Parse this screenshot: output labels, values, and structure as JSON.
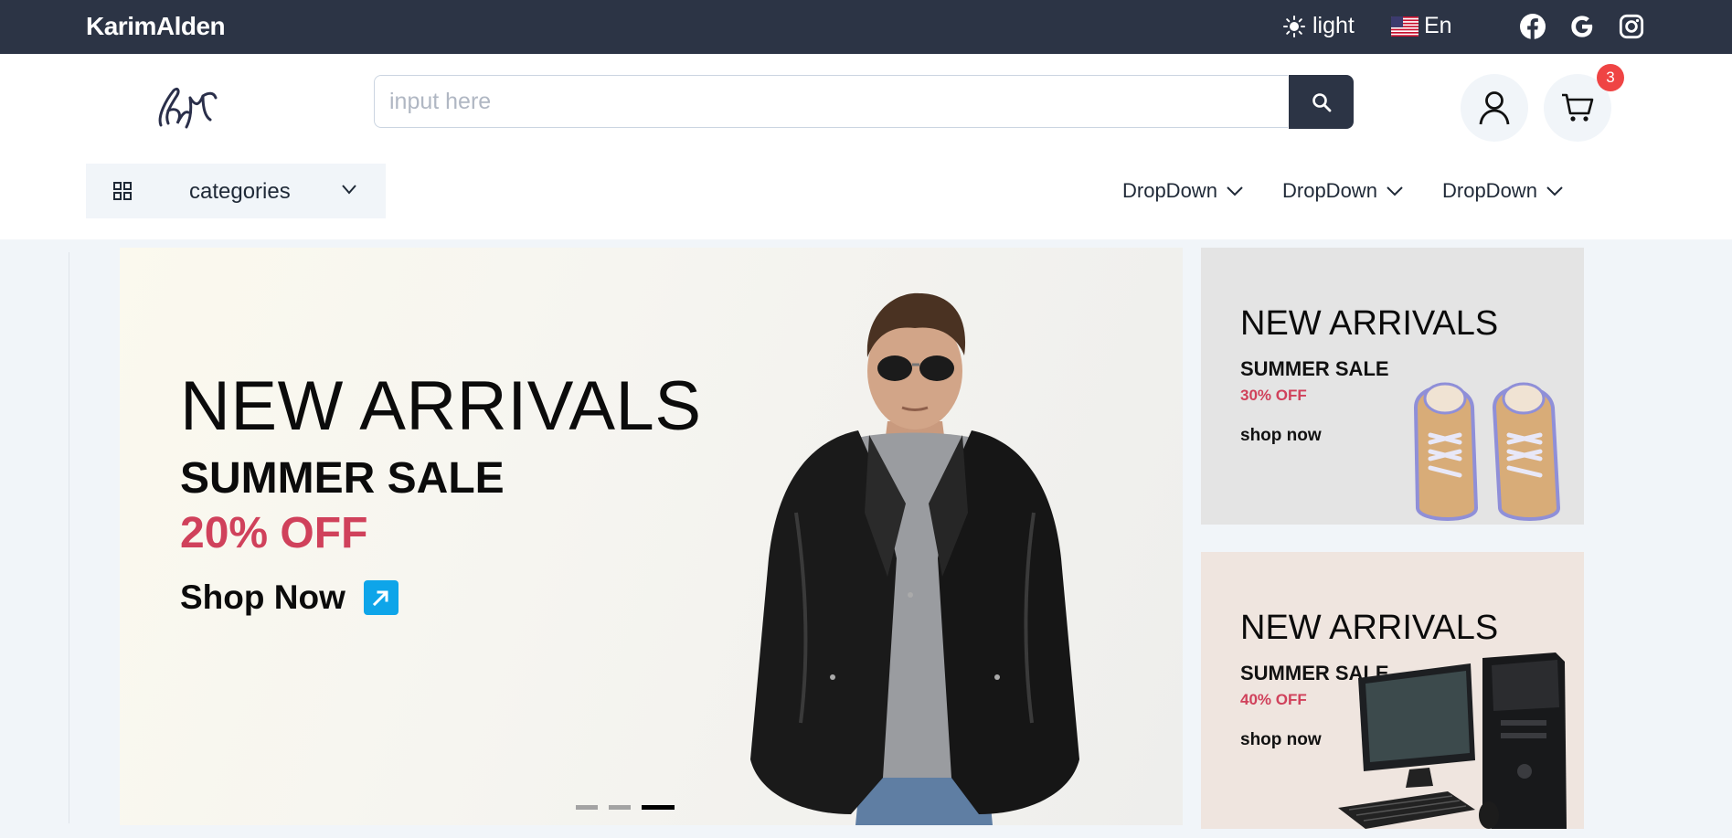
{
  "topbar": {
    "brand": "KarimAlden",
    "theme_label": "light",
    "language_label": "En",
    "socials": [
      "facebook-icon",
      "google-icon",
      "instagram-icon"
    ]
  },
  "header": {
    "search_placeholder": "input here",
    "cart_count": "3",
    "categories_label": "categories",
    "nav": [
      "DropDown",
      "DropDown",
      "DropDown"
    ]
  },
  "hero": {
    "title": "NEW ARRIVALS",
    "subtitle": "SUMMER SALE",
    "discount": "20% OFF",
    "cta": "Shop Now",
    "slides": 3,
    "active_slide": 3
  },
  "promos": [
    {
      "title": "NEW ARRIVALS",
      "subtitle": "SUMMER SALE",
      "discount": "30% OFF",
      "cta": "shop now",
      "image": "sneakers"
    },
    {
      "title": "NEW ARRIVALS",
      "subtitle": "SUMMER SALE",
      "discount": "40% OFF",
      "cta": "shop now",
      "image": "desktop-computer"
    }
  ],
  "colors": {
    "dark": "#2c3445",
    "accent_red": "#d0415b",
    "badge": "#ef4444",
    "cta_blue": "#0ea5e9",
    "page_bg": "#f1f5f9"
  }
}
